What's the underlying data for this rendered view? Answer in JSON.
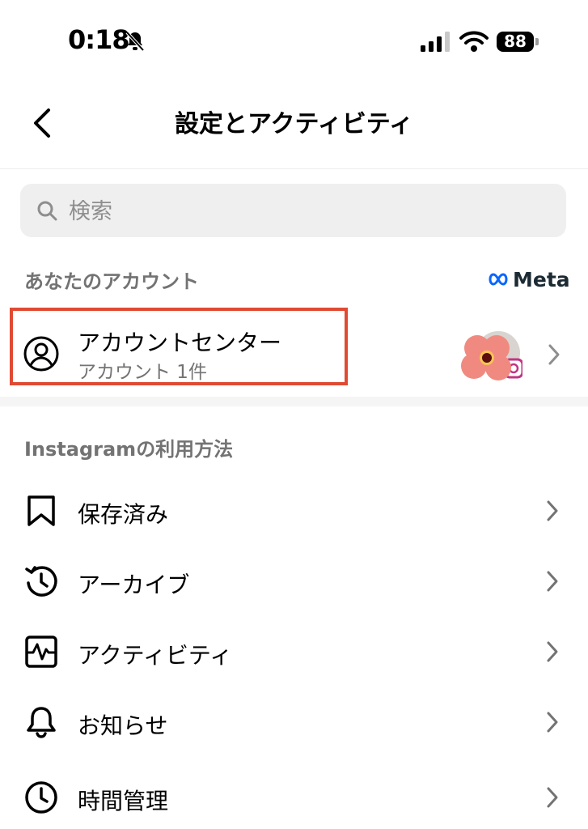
{
  "status_bar": {
    "time": "0:18",
    "battery": "88"
  },
  "header": {
    "title": "設定とアクティビティ"
  },
  "search": {
    "placeholder": "検索"
  },
  "account_section": {
    "heading": "あなたのアカウント",
    "meta_label": "Meta",
    "account_center": {
      "title": "アカウントセンター",
      "subtitle": "アカウント 1件"
    }
  },
  "usage_section": {
    "heading": "Instagramの利用方法",
    "items": [
      {
        "label": "保存済み",
        "icon": "bookmark-icon"
      },
      {
        "label": "アーカイブ",
        "icon": "archive-icon"
      },
      {
        "label": "アクティビティ",
        "icon": "activity-icon"
      },
      {
        "label": "お知らせ",
        "icon": "bell-icon"
      },
      {
        "label": "時間管理",
        "icon": "clock-icon"
      }
    ]
  },
  "colors": {
    "highlight_border": "#e04a33",
    "secondary_text": "#737373",
    "search_bg": "#efefef"
  }
}
